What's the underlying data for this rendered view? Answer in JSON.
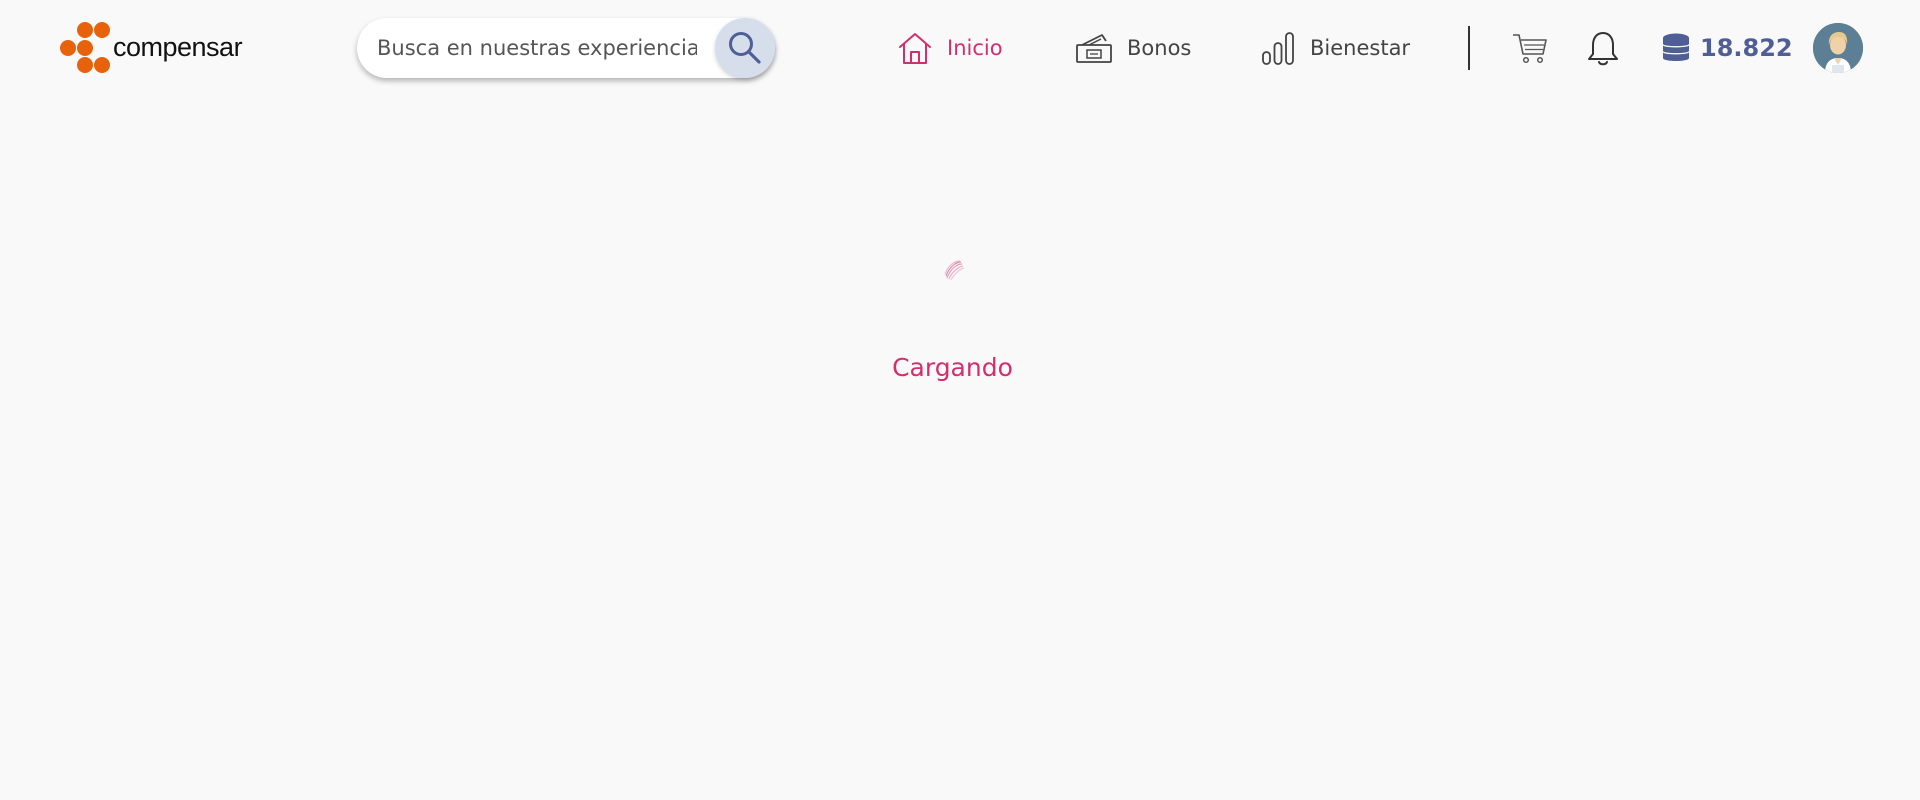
{
  "brand": {
    "name": "compensar",
    "logo_color": "#e8620c"
  },
  "search": {
    "placeholder": "Busca en nuestras experiencias",
    "icon": "search-icon"
  },
  "nav": {
    "items": [
      {
        "label": "Inicio",
        "icon": "home-icon",
        "active": true
      },
      {
        "label": "Bonos",
        "icon": "ticket-icon",
        "active": false
      },
      {
        "label": "Bienestar",
        "icon": "bar-chart-icon",
        "active": false
      }
    ]
  },
  "actions": {
    "cart_icon": "cart-icon",
    "bell_icon": "bell-icon"
  },
  "points": {
    "value": "18.822",
    "icon": "coins-stack-icon"
  },
  "user": {
    "avatar_icon": "user-avatar-icon"
  },
  "loading": {
    "text": "Cargando"
  },
  "colors": {
    "accent": "#d12f6e",
    "nav_text": "#444444",
    "points": "#4f5f96",
    "search_button_bg": "#d6deec",
    "page_bg": "#f9f9f9"
  }
}
